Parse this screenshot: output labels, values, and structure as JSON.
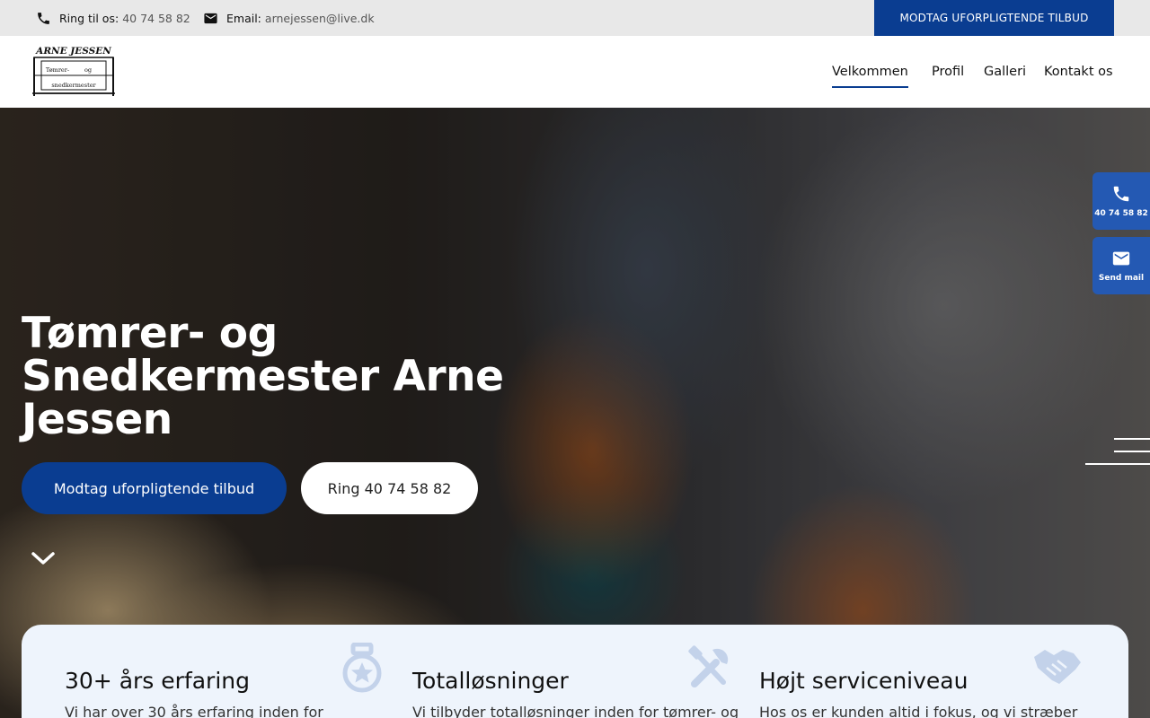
{
  "topbar": {
    "phone_label": "Ring til os:",
    "phone_value": "40 74 58 82",
    "email_label": "Email:",
    "email_value": "arnejessen@live.dk",
    "cta": "MODTAG UFORPLIGTENDE TILBUD"
  },
  "logo": {
    "top_text": "ARNE JESSEN",
    "line1a": "Tømrer-",
    "line1b": "og",
    "line2": "snedkermester"
  },
  "nav": [
    "Velkommen",
    "Profil",
    "Galleri",
    "Kontakt os"
  ],
  "hero": {
    "title": "Tømrer- og Snedkermester Arne Jessen",
    "primary_button": "Modtag uforpligtende tilbud",
    "secondary_button": "Ring 40 74 58 82"
  },
  "side_contact": {
    "phone": "40 74 58 82",
    "mail": "Send mail"
  },
  "features": [
    {
      "title": "30+  års erfaring",
      "text": "Vi har over 30 års erfaring inden for",
      "icon": "medal-icon"
    },
    {
      "title": "Totalløsninger",
      "text": "Vi tilbyder totalløsninger inden for tømrer- og",
      "icon": "tools-icon"
    },
    {
      "title": "Højt serviceniveau",
      "text": "Hos os er kunden altid i fokus, og vi stræber",
      "icon": "handshake-icon"
    }
  ],
  "colors": {
    "primary": "#0a3d91",
    "side_button": "#2459b3",
    "feature_bg": "#eef4fc",
    "feature_icon": "#c3d2ea"
  }
}
